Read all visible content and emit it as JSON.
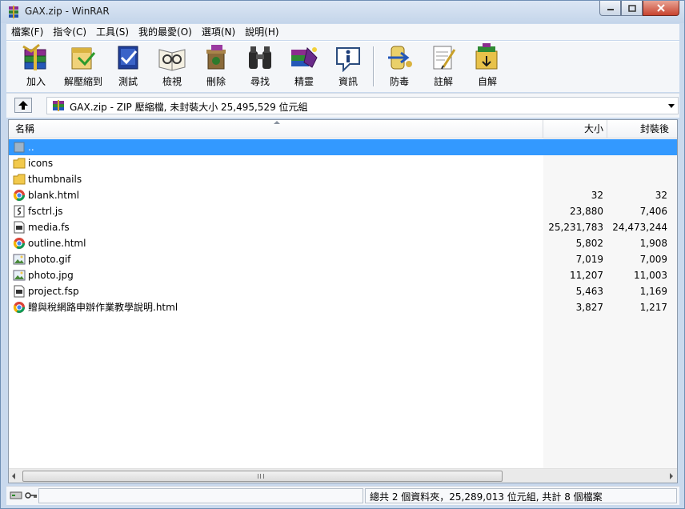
{
  "window": {
    "title": "GAX.zip - WinRAR"
  },
  "menu": [
    {
      "label": "檔案(F)"
    },
    {
      "label": "指令(C)"
    },
    {
      "label": "工具(S)"
    },
    {
      "label": "我的最愛(O)"
    },
    {
      "label": "選項(N)"
    },
    {
      "label": "說明(H)"
    }
  ],
  "toolbar": [
    {
      "label": "加入",
      "icon": "books-add-icon"
    },
    {
      "label": "解壓縮到",
      "icon": "extract-icon"
    },
    {
      "label": "測試",
      "icon": "test-icon"
    },
    {
      "label": "檢視",
      "icon": "view-icon"
    },
    {
      "label": "刪除",
      "icon": "delete-icon"
    },
    {
      "label": "尋找",
      "icon": "binoculars-icon"
    },
    {
      "label": "精靈",
      "icon": "wizard-icon"
    },
    {
      "label": "資訊",
      "icon": "info-icon"
    },
    {
      "label": "防毒",
      "icon": "virus-scan-icon"
    },
    {
      "label": "註解",
      "icon": "comment-icon"
    },
    {
      "label": "自解",
      "icon": "sfx-icon"
    }
  ],
  "address": {
    "text": "GAX.zip - ZIP 壓縮檔, 未封裝大小 25,495,529 位元組"
  },
  "columns": {
    "name": "名稱",
    "size": "大小",
    "packed": "封裝後"
  },
  "files": [
    {
      "name": "..",
      "size": "",
      "packed": "",
      "type": "parent"
    },
    {
      "name": "icons",
      "size": "",
      "packed": "",
      "type": "folder"
    },
    {
      "name": "thumbnails",
      "size": "",
      "packed": "",
      "type": "folder"
    },
    {
      "name": "blank.html",
      "size": "32",
      "packed": "32",
      "type": "html"
    },
    {
      "name": "fsctrl.js",
      "size": "23,880",
      "packed": "7,406",
      "type": "js"
    },
    {
      "name": "media.fs",
      "size": "25,231,783",
      "packed": "24,473,244",
      "type": "file"
    },
    {
      "name": "outline.html",
      "size": "5,802",
      "packed": "1,908",
      "type": "html"
    },
    {
      "name": "photo.gif",
      "size": "7,019",
      "packed": "7,009",
      "type": "image"
    },
    {
      "name": "photo.jpg",
      "size": "11,207",
      "packed": "11,003",
      "type": "image"
    },
    {
      "name": "project.fsp",
      "size": "5,463",
      "packed": "1,169",
      "type": "file"
    },
    {
      "name": "贈與稅網路申辦作業教學說明.html",
      "size": "3,827",
      "packed": "1,217",
      "type": "html"
    }
  ],
  "status": {
    "left": "",
    "right": "總共 2 個資料夾，25,289,013 位元組, 共計 8 個檔案"
  },
  "colors": {
    "selection": "#3399ff",
    "chrome": "#c9d9ed"
  }
}
